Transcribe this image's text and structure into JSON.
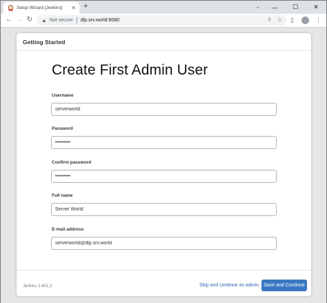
{
  "browser": {
    "tab_title": "Setup Wizard [Jenkins]",
    "new_tab_glyph": "+",
    "security_label": "Not secure",
    "url": "dlp.srv.world:8080"
  },
  "dialog": {
    "header_title": "Getting Started",
    "heading": "Create First Admin User",
    "fields": [
      {
        "label": "Username",
        "value": "serverworld",
        "type": "text"
      },
      {
        "label": "Password",
        "value": "•••••••••",
        "type": "password"
      },
      {
        "label": "Confirm password",
        "value": "•••••••••",
        "type": "password"
      },
      {
        "label": "Full name",
        "value": "Server World",
        "type": "text"
      },
      {
        "label": "E-mail address",
        "value": "serverworld@dlp.srv.world",
        "type": "text"
      }
    ],
    "footer": {
      "version": "Jenkins 2.401.2",
      "skip_label": "Skip and continue as admin",
      "save_label": "Save and Continue"
    }
  },
  "colors": {
    "accent": "#3b78c2",
    "link": "#3367b4"
  }
}
